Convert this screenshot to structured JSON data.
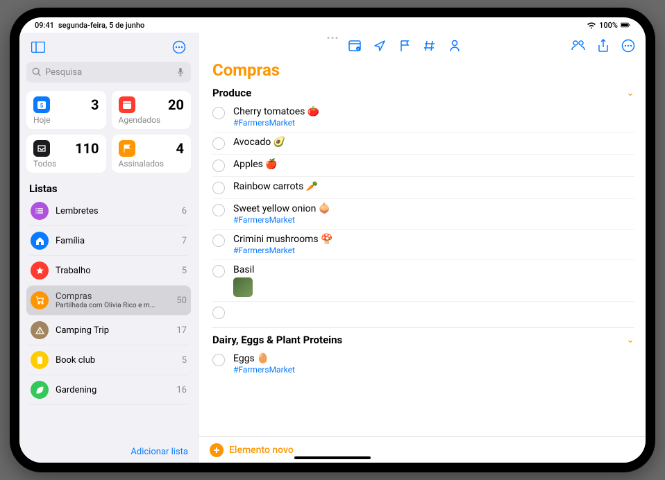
{
  "statusbar": {
    "time": "09:41",
    "date": "segunda-feira, 5 de junho",
    "battery": "100%"
  },
  "sidebar": {
    "search_placeholder": "Pesquisa",
    "cards": [
      {
        "label": "Hoje",
        "count": "3"
      },
      {
        "label": "Agendados",
        "count": "20"
      },
      {
        "label": "Todos",
        "count": "110"
      },
      {
        "label": "Assinalados",
        "count": "4"
      }
    ],
    "lists_title": "Listas",
    "lists": [
      {
        "name": "Lembretes",
        "count": "6",
        "color": "li-purple",
        "icon": "list"
      },
      {
        "name": "Família",
        "count": "7",
        "color": "li-blue",
        "icon": "home"
      },
      {
        "name": "Trabalho",
        "count": "5",
        "color": "li-red",
        "icon": "star"
      },
      {
        "name": "Compras",
        "sub": "Partilhada com Olivia Rico e m...",
        "count": "50",
        "color": "li-orange",
        "icon": "cart",
        "selected": true
      },
      {
        "name": "Camping Trip",
        "count": "17",
        "color": "li-brown",
        "icon": "tent"
      },
      {
        "name": "Book club",
        "count": "5",
        "color": "li-yellow",
        "icon": "book"
      },
      {
        "name": "Gardening",
        "count": "16",
        "color": "li-green",
        "icon": "leaf"
      }
    ],
    "add_list": "Adicionar lista"
  },
  "main": {
    "title": "Compras",
    "sections": [
      {
        "name": "Produce",
        "items": [
          {
            "text": "Cherry tomatoes 🍅",
            "tag": "#FarmersMarket"
          },
          {
            "text": "Avocado 🥑"
          },
          {
            "text": "Apples 🍎"
          },
          {
            "text": "Rainbow carrots 🥕"
          },
          {
            "text": "Sweet yellow onion 🧅",
            "tag": "#FarmersMarket"
          },
          {
            "text": "Crimini mushrooms 🍄",
            "tag": "#FarmersMarket"
          },
          {
            "text": "Basil",
            "thumb": true
          },
          {
            "empty": true
          }
        ]
      },
      {
        "name": "Dairy, Eggs & Plant Proteins",
        "items": [
          {
            "text": "Eggs 🥚",
            "tag": "#FarmersMarket"
          }
        ]
      }
    ],
    "add_item": "Elemento novo"
  }
}
